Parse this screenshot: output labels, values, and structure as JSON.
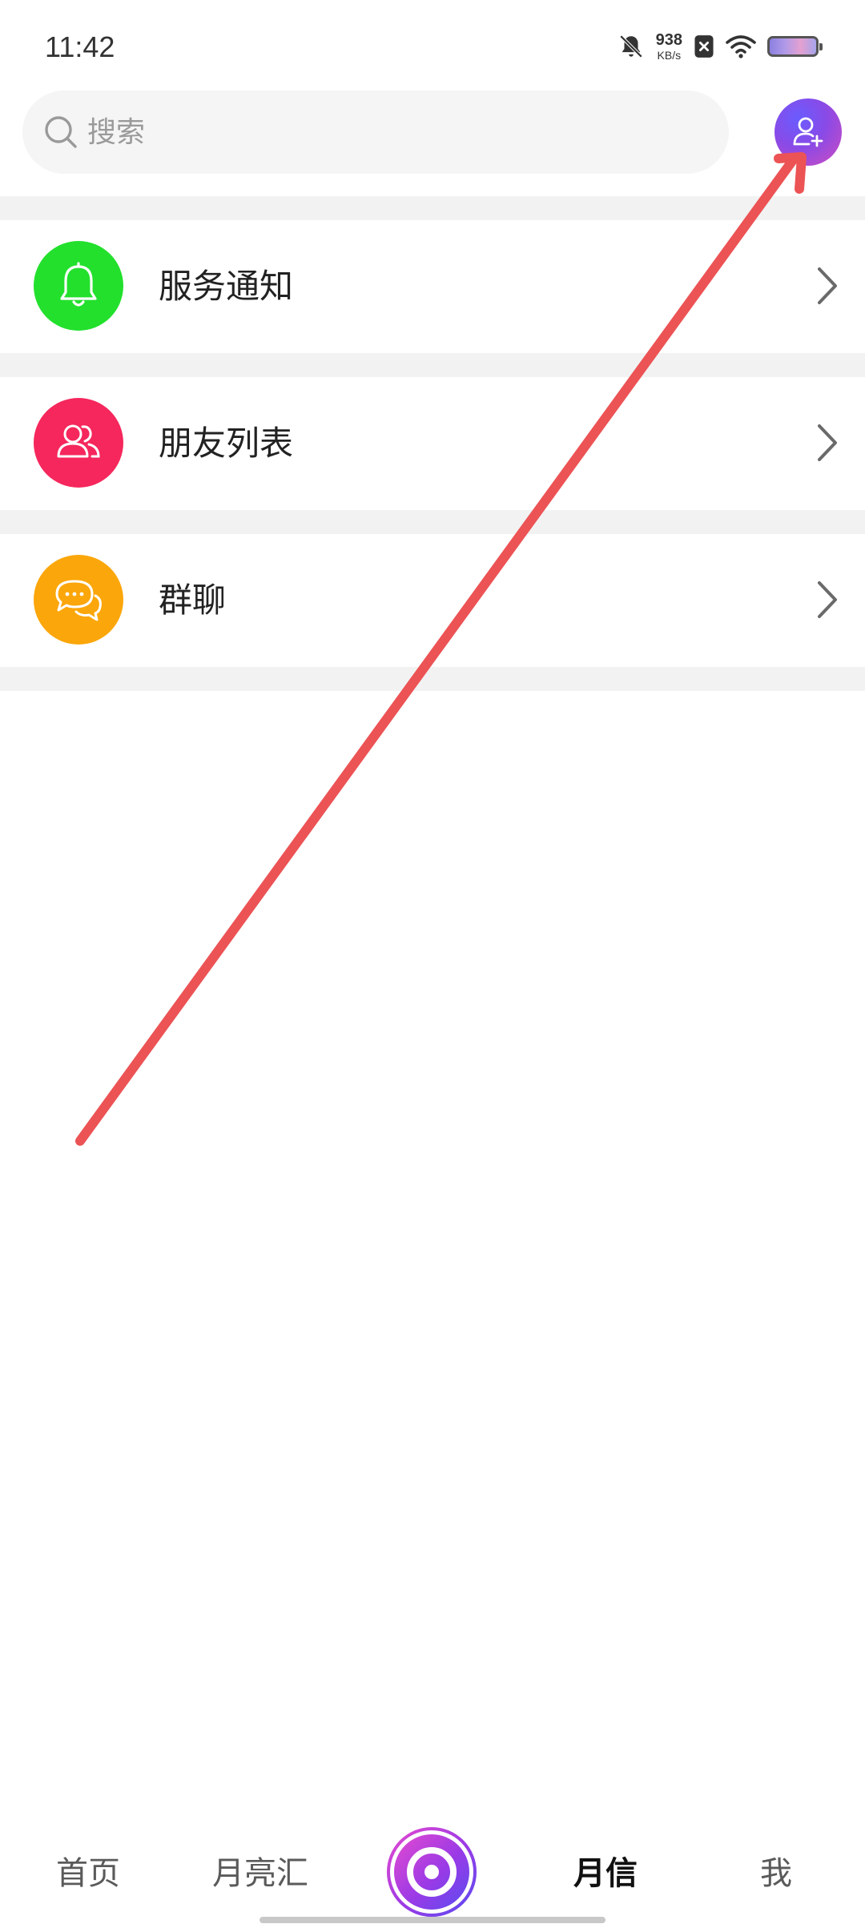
{
  "status_bar": {
    "time": "11:42",
    "net_speed_value": "938",
    "net_speed_unit": "KB/s",
    "icons": [
      "bell-off-icon",
      "close-box-icon",
      "wifi-icon",
      "battery-icon"
    ]
  },
  "search": {
    "placeholder": "搜索",
    "icon": "search-icon"
  },
  "header": {
    "add_friend_icon": "person-add-icon",
    "add_friend_colors": [
      "#6a5cff",
      "#d04cc0"
    ]
  },
  "list": {
    "items": [
      {
        "label": "服务通知",
        "icon": "bell-icon",
        "color": "#22e02c"
      },
      {
        "label": "朋友列表",
        "icon": "users-icon",
        "color": "#f5275c"
      },
      {
        "label": "群聊",
        "icon": "chat-bubbles-icon",
        "color": "#fba60a"
      }
    ]
  },
  "bottom_nav": {
    "items": [
      {
        "label": "首页",
        "active": false
      },
      {
        "label": "月亮汇",
        "active": false
      },
      {
        "label": "",
        "icon": "center-target-icon",
        "active": false
      },
      {
        "label": "月信",
        "active": true
      },
      {
        "label": "我",
        "active": false
      }
    ]
  },
  "annotation": {
    "type": "arrow",
    "color": "#ec5355"
  }
}
